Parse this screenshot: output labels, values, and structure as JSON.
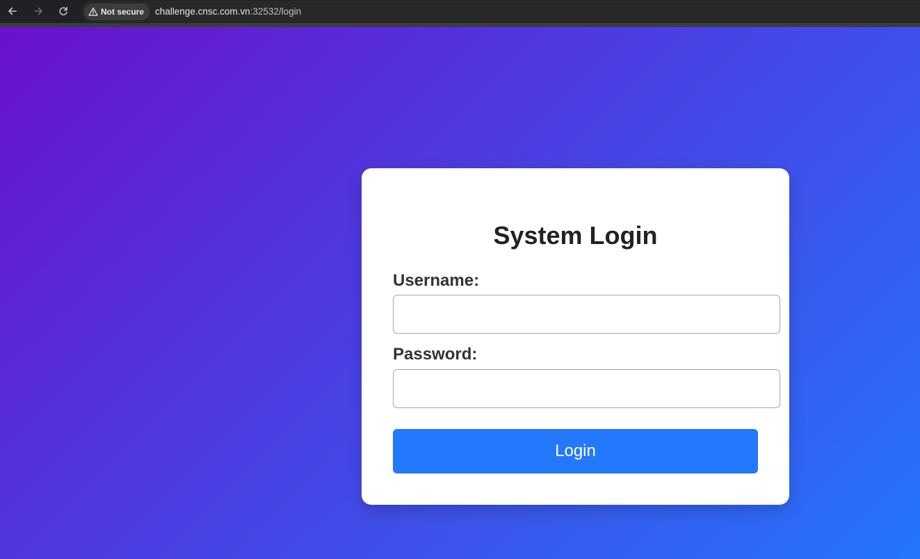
{
  "browser": {
    "security_label": "Not secure",
    "url_host": "challenge.cnsc.com.vn",
    "url_rest": ":32532/login",
    "icons": {
      "back": "back-arrow-icon",
      "forward": "forward-arrow-icon",
      "reload": "reload-icon",
      "security": "warning-triangle-icon"
    }
  },
  "login": {
    "title": "System Login",
    "username_label": "Username:",
    "username_value": "",
    "password_label": "Password:",
    "password_value": "",
    "submit_label": "Login"
  },
  "colors": {
    "gradient_start": "#6a11cb",
    "gradient_end": "#2575fc",
    "button": "#2378fb",
    "card": "#ffffff"
  }
}
